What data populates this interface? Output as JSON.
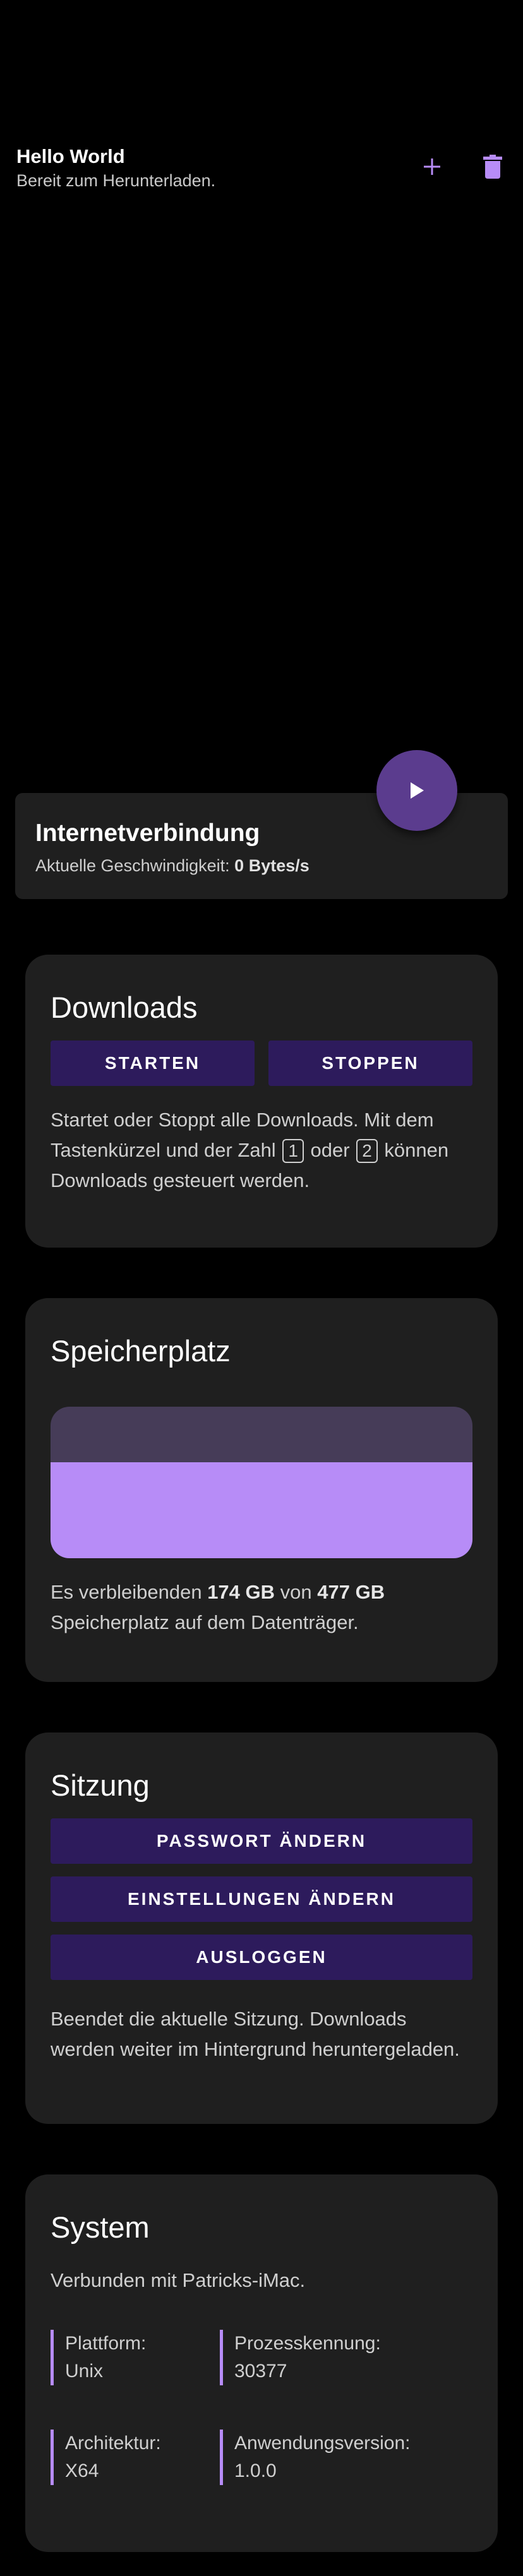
{
  "header": {
    "title": "Hello World",
    "subtitle": "Bereit zum Herunterladen."
  },
  "icons": {
    "add": "plus-icon",
    "delete": "trash-icon",
    "play": "play-icon"
  },
  "colors": {
    "accent": "#b78cf7",
    "button_bg": "#2d1b5c",
    "fab_bg": "#5b3c8e",
    "card_bg": "#1f1f1f",
    "background": "#000000"
  },
  "connection": {
    "title": "Internetverbindung",
    "speed_label": "Aktuelle Geschwindigkeit:",
    "speed_value": "0 Bytes/s"
  },
  "downloads": {
    "title": "Downloads",
    "start_label": "STARTEN",
    "stop_label": "STOPPEN",
    "desc_part1": "Startet oder Stoppt alle Downloads. Mit dem Tastenkürzel und der Zahl",
    "key1": "1",
    "desc_oder": "oder",
    "key2": "2",
    "desc_part2": "können Downloads gesteuert werden."
  },
  "storage": {
    "title": "Speicherplatz",
    "free_fraction": 0.635,
    "desc_prefix": "Es verbleibenden",
    "free": "174 GB",
    "desc_von": "von",
    "total": "477 GB",
    "desc_suffix": "Speicherplatz auf dem Datenträger."
  },
  "session": {
    "title": "Sitzung",
    "change_password_label": "PASSWORT ÄNDERN",
    "change_settings_label": "EINSTELLUNGEN ÄNDERN",
    "logout_label": "AUSLOGGEN",
    "desc": "Beendet die aktuelle Sitzung. Downloads werden weiter im Hintergrund heruntergeladen."
  },
  "system": {
    "title": "System",
    "connected": "Verbunden mit Patricks-iMac.",
    "platform_label": "Plattform:",
    "platform_value": "Unix",
    "pid_label": "Prozesskennung:",
    "pid_value": "30377",
    "arch_label": "Architektur:",
    "arch_value": "X64",
    "version_label": "Anwendungsversion:",
    "version_value": "1.0.0"
  }
}
